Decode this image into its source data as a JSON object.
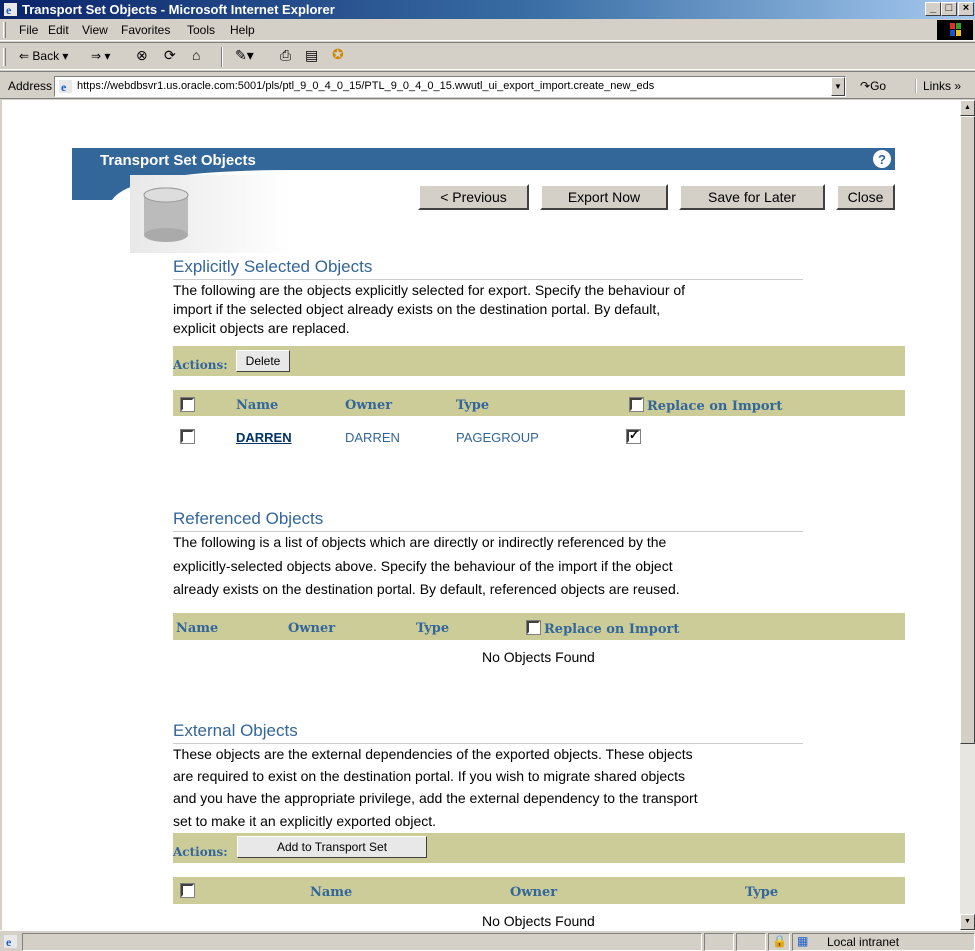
{
  "window": {
    "title": "Transport Set Objects - Microsoft Internet Explorer"
  },
  "menu": [
    "File",
    "Edit",
    "View",
    "Favorites",
    "Tools",
    "Help"
  ],
  "toolbar": {
    "back": "Back"
  },
  "address": {
    "label": "Address",
    "url": "https://webdbsvr1.us.oracle.com:5001/pls/ptl_9_0_4_0_15/PTL_9_0_4_0_15.wwutl_ui_export_import.create_new_eds",
    "go": "Go",
    "links": "Links »"
  },
  "page": {
    "title": "Transport Set Objects",
    "help": "?",
    "buttons": {
      "previous": "< Previous",
      "export": "Export Now",
      "save": "Save for Later",
      "close": "Close"
    }
  },
  "explicit": {
    "title": "Explicitly Selected Objects",
    "desc1": "The following are the objects explicitly selected for export. Specify the behaviour of",
    "desc2": "import if the selected object already exists on the destination portal. By default,",
    "desc3": "explicit objects are replaced.",
    "actions": "Actions:",
    "delete": "Delete",
    "headers": {
      "name": "Name",
      "owner": "Owner",
      "type": "Type",
      "replace": "Replace on Import"
    },
    "rows": [
      {
        "name": "DARREN",
        "owner": "DARREN",
        "type": "PAGEGROUP",
        "replace": true
      }
    ]
  },
  "referenced": {
    "title": "Referenced Objects",
    "desc1": "The following is a list of objects which are directly or indirectly referenced by the",
    "desc2": "explicitly-selected objects above. Specify the behaviour of the import if the object",
    "desc3": "already exists on the destination portal. By default, referenced objects are reused.",
    "headers": {
      "name": "Name",
      "owner": "Owner",
      "type": "Type",
      "replace": "Replace on Import"
    },
    "empty": "No Objects Found"
  },
  "external": {
    "title": "External Objects",
    "desc1": "These objects are the external dependencies of the exported objects. These objects",
    "desc2": "are required to exist on the destination portal. If you wish to migrate shared objects",
    "desc3": "and you have the appropriate privilege, add the external dependency to the transport",
    "desc4": "set to make it an explicitly exported object.",
    "actions": "Actions:",
    "add": "Add to Transport Set",
    "headers": {
      "name": "Name",
      "owner": "Owner",
      "type": "Type"
    },
    "empty": "No Objects Found"
  },
  "status": {
    "zone": "Local intranet"
  },
  "colors": {
    "accent": "#336699",
    "bar": "#cccc99"
  }
}
